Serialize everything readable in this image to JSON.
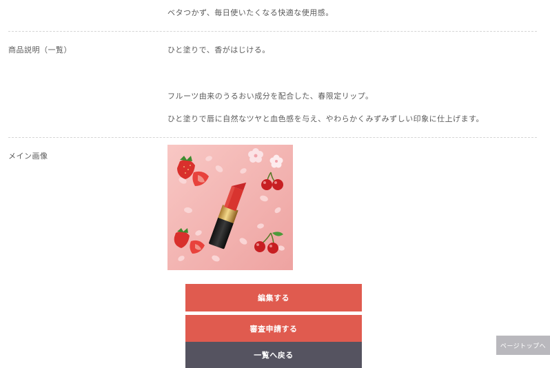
{
  "top_text": "ベタつかず、毎日使いたくなる快適な使用感。",
  "description": {
    "label": "商品説明（一覧）",
    "lines": [
      "ひと塗りで、香がはじける。",
      "フルーツ由来のうるおい成分を配合した、春限定リップ。",
      "ひと塗りで唇に自然なツヤと血色感を与え、やわらかくみずみずしい印象に仕上げます。"
    ]
  },
  "main_image": {
    "label": "メイン画像",
    "colors": {
      "background": "#f4b8b6",
      "lipstick": "#d8342f",
      "strawberry": "#d9302c",
      "cherry": "#c71f22"
    }
  },
  "buttons": {
    "edit": "編集する",
    "review": "審査申請する",
    "back": "一覧へ戻る"
  },
  "page_top": {
    "label": "ページトップへ"
  },
  "colors": {
    "accent": "#e05b4f",
    "secondary_button": "#555360",
    "page_top_bg": "#b9b8bd"
  }
}
